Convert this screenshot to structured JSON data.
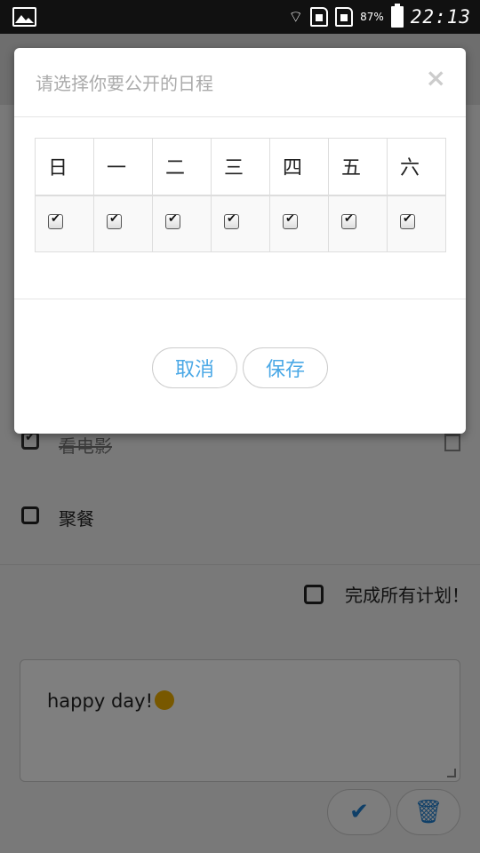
{
  "status_bar": {
    "battery_percent": "87%",
    "time": "22:13"
  },
  "todos": [
    {
      "label": "看电影",
      "done": true
    },
    {
      "label": "聚餐",
      "done": false
    }
  ],
  "complete_all_label": "完成所有计划！",
  "note": {
    "text": "happy day!"
  },
  "icons": {
    "confirm": "check-icon",
    "delete": "trash-icon"
  },
  "modal": {
    "title": "请选择你要公开的日程",
    "close": "×",
    "days": [
      "日",
      "一",
      "二",
      "三",
      "四",
      "五",
      "六"
    ],
    "checked": [
      true,
      true,
      true,
      true,
      true,
      true,
      true
    ],
    "cancel_label": "取消",
    "save_label": "保存"
  },
  "colors": {
    "accent": "#4aa8e6",
    "icon_blue": "#1e7fd0"
  }
}
